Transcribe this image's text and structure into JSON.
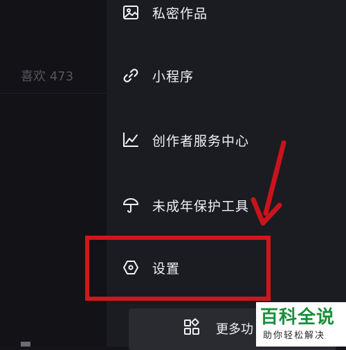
{
  "left_pane": {
    "tab_label": "喜欢 473"
  },
  "menu": {
    "items": [
      {
        "label": "私密作品",
        "icon": "image-icon"
      },
      {
        "label": "小程序",
        "icon": "link-icon"
      },
      {
        "label": "创作者服务中心",
        "icon": "chart-icon"
      },
      {
        "label": "未成年保护工具",
        "icon": "umbrella-icon"
      },
      {
        "label": "设置",
        "icon": "hexagon-settings-icon"
      }
    ]
  },
  "more_button": {
    "label": "更多功",
    "icon": "grid-icon"
  },
  "annotation": {
    "box_color": "#d0171a",
    "arrow_color": "#c8141a"
  },
  "watermark": {
    "title": "百科全说",
    "subtitle": "助你轻松解决"
  }
}
